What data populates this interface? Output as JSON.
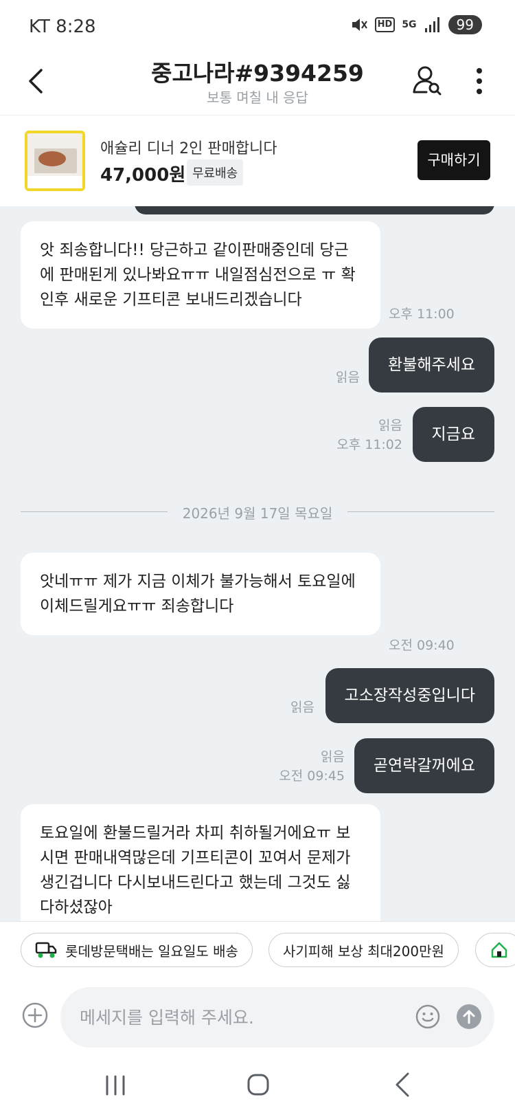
{
  "status_bar": {
    "time": "KT 8:28",
    "hd": "HD",
    "network": "5G",
    "battery": "99"
  },
  "header": {
    "title": "중고나라#9394259",
    "subtitle": "보통 며칠 내 응답"
  },
  "product": {
    "name": "애슐리 디너 2인 판매합니다",
    "price": "47,000원",
    "shipping_badge": "무료배송",
    "buy_label": "구매하기"
  },
  "messages": [
    {
      "dir": "in",
      "text": "앗 죄송합니다!! 당근하고 같이판매중인데 당근에 판매된게 있나봐요ㅠㅠ 내일점심전으로 ㅠ 확인후 새로운 기프티콘 보내드리겠습니다",
      "time": "오후 11:00"
    },
    {
      "dir": "out",
      "text": "환불해주세요",
      "read": "읽음"
    },
    {
      "dir": "out",
      "text": "지금요",
      "read": "읽음",
      "time": "오후 11:02"
    },
    {
      "dir": "in",
      "text": "앗네ㅠㅠ 제가 지금 이체가 불가능해서 토요일에 이체드릴게요ㅠㅠ 죄송합니다",
      "time": "오전 09:40"
    },
    {
      "dir": "out",
      "text": "고소장작성중입니다",
      "read": "읽음"
    },
    {
      "dir": "out",
      "text": "곧연락갈꺼에요",
      "read": "읽음",
      "time": "오전 09:45"
    },
    {
      "dir": "in",
      "text": "토요일에 환불드릴거라 차피 취하될거에요ㅠ 보시면 판매내역많은데 기프티콘이 꼬여서 문제가 생긴겁니다 다시보내드린다고 했는데 그것도 싫다하셨잖아"
    }
  ],
  "date_divider": "2026년 9월 17일 목요일",
  "chips": [
    {
      "label": "롯데방문택배는 일요일도 배송",
      "icon": "truck-icon"
    },
    {
      "label": "사기피해 보상 최대200만원"
    },
    {
      "label": "",
      "icon": "house-icon"
    }
  ],
  "input": {
    "placeholder": "메세지를 입력해 주세요."
  },
  "colors": {
    "bubble_out": "#353b41",
    "chat_bg": "#eef1f4",
    "buy_button": "#141414",
    "thumb_border": "#f2d72b"
  }
}
